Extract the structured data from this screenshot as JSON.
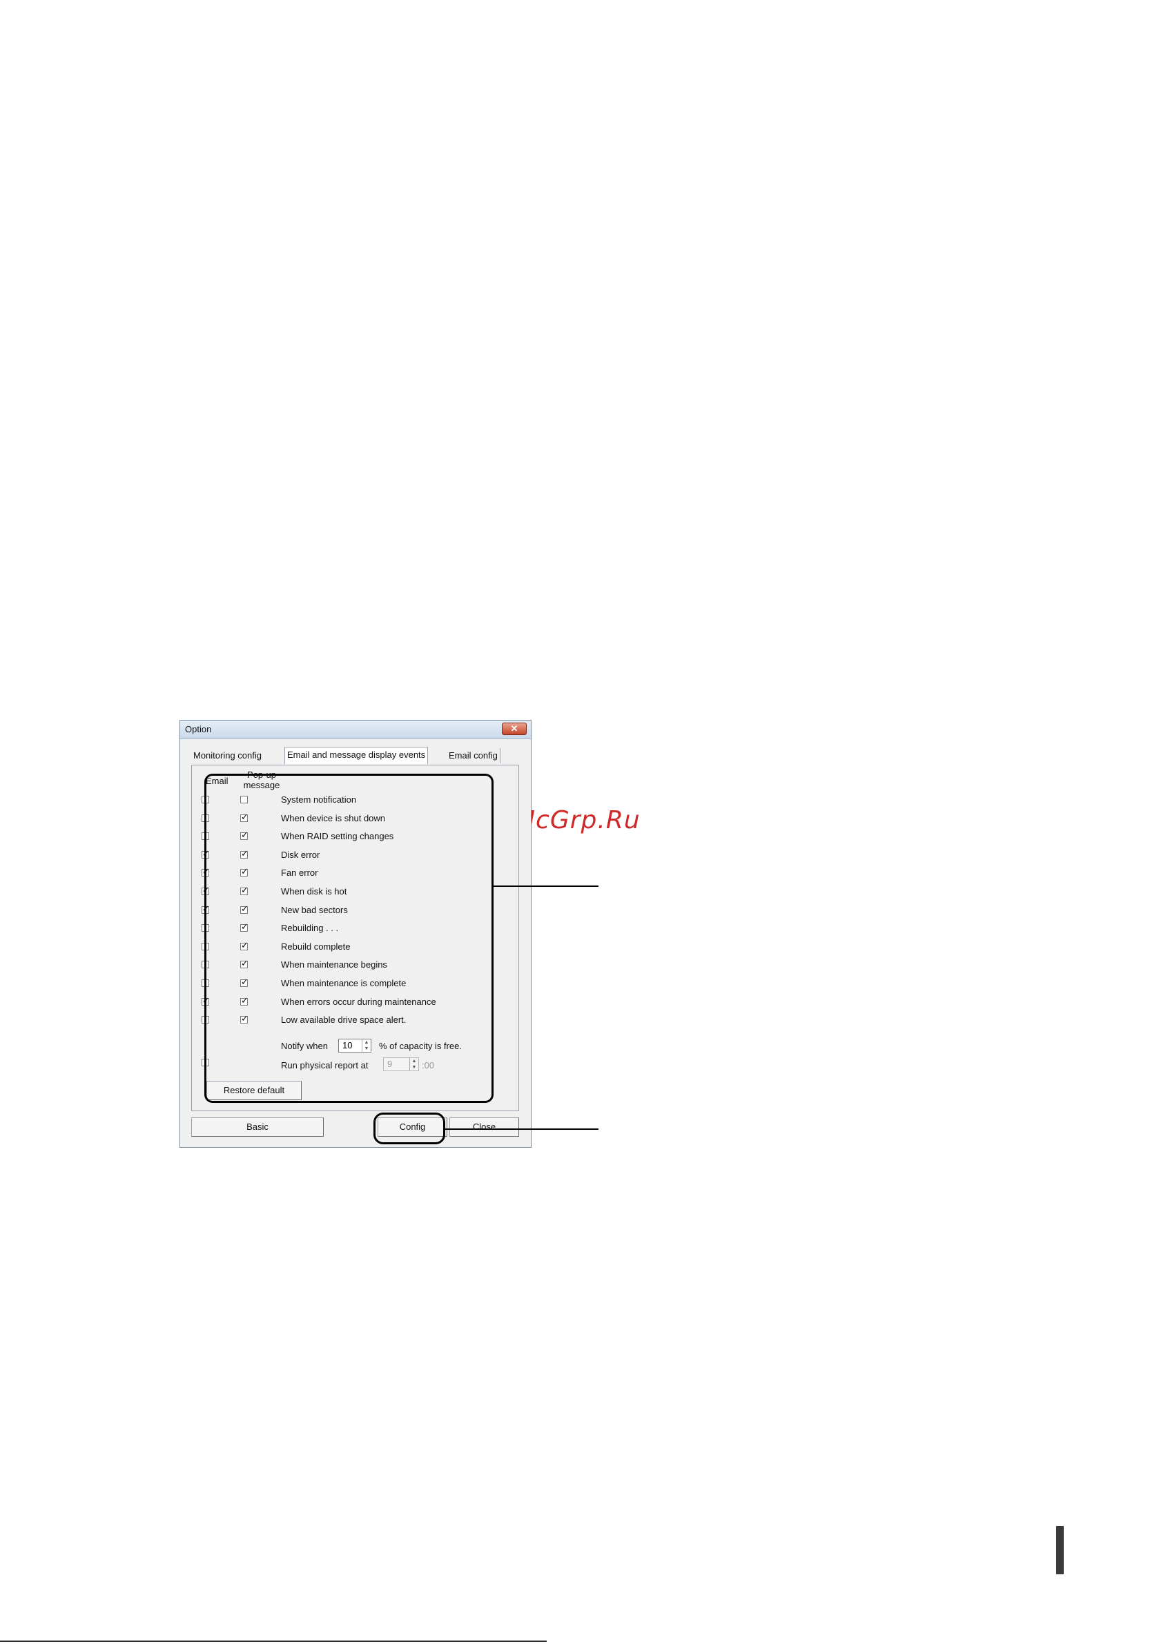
{
  "watermark": "McGrp.Ru",
  "dialog": {
    "title": "Option",
    "close_glyph": "✕",
    "tabs": [
      {
        "label": "Monitoring config",
        "active": false
      },
      {
        "label": "Email and message display events",
        "active": true
      },
      {
        "label": "Email config",
        "active": false
      }
    ],
    "columns": {
      "email": "Email",
      "popup": "Pop-up message"
    },
    "events": [
      {
        "label": "System notification",
        "email": false,
        "popup": false
      },
      {
        "label": "When device is shut down",
        "email": false,
        "popup": true
      },
      {
        "label": "When RAID setting changes",
        "email": false,
        "popup": true
      },
      {
        "label": "Disk error",
        "email": true,
        "popup": true
      },
      {
        "label": "Fan error",
        "email": true,
        "popup": true
      },
      {
        "label": "When disk is hot",
        "email": true,
        "popup": true
      },
      {
        "label": "New bad sectors",
        "email": true,
        "popup": true
      },
      {
        "label": "Rebuilding . . .",
        "email": false,
        "popup": true
      },
      {
        "label": "Rebuild complete",
        "email": false,
        "popup": true
      },
      {
        "label": "When maintenance begins",
        "email": false,
        "popup": true
      },
      {
        "label": "When maintenance is complete",
        "email": false,
        "popup": true
      },
      {
        "label": "When errors occur during maintenance",
        "email": true,
        "popup": true
      },
      {
        "label": "Low available drive space alert.",
        "email": false,
        "popup": true
      }
    ],
    "notify": {
      "prefix": "Notify when",
      "value": "10",
      "suffix": "% of capacity is free."
    },
    "report": {
      "label": "Run physical report at",
      "hour": "9",
      "minutes": ":00",
      "checked": false
    },
    "restore_default_label": "Restore default",
    "buttons": {
      "basic": "Basic",
      "config": "Config",
      "close": "Close"
    }
  }
}
